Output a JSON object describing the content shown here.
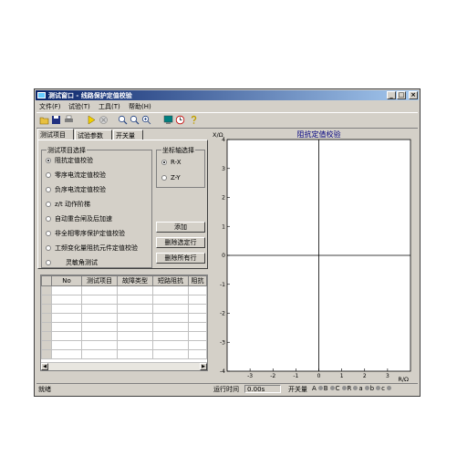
{
  "window": {
    "title": "测试窗口 - 线路保护定值校验"
  },
  "menu": [
    "文件(F)",
    "试验(T)",
    "工具(T)",
    "帮助(H)"
  ],
  "tabs": [
    "测试项目",
    "试验参数",
    "开关量"
  ],
  "test_group": {
    "title": "测试项目选择",
    "items": [
      "阻抗定值校验",
      "零序电流定值校验",
      "负序电流定值校验",
      "z/t 动作阶梯",
      "自动重合闸及后加速",
      "非全相零序保护定值校验",
      "工频变化量阻抗元件定值校验",
      "灵敏角测试"
    ],
    "selected": 0
  },
  "coord_group": {
    "title": "坐标轴选择",
    "options": [
      "R-X",
      "Z-Y"
    ],
    "selected": 0
  },
  "buttons": {
    "add": "添加",
    "delete_selected": "删除选定行",
    "delete_all": "删除所有行"
  },
  "table": {
    "headers": [
      "No",
      "测试项目",
      "故障类型",
      "短路阻抗",
      "阻抗"
    ]
  },
  "chart_data": {
    "type": "scatter",
    "title": "阻抗定值校验",
    "xlabel": "R/Ω",
    "ylabel": "X/Ω",
    "xlim": [
      -4,
      4
    ],
    "ylim": [
      -4,
      4
    ],
    "xticks": [
      -3,
      -2,
      -1,
      0,
      1,
      2,
      3
    ],
    "yticks": [
      -4,
      -3,
      -2,
      -1,
      0,
      1,
      2,
      3,
      4
    ],
    "series": []
  },
  "status": {
    "text": "就绪",
    "runtime_label": "运行时间",
    "runtime_value": "0.00s",
    "switch_label": "开关量",
    "leds": [
      "A",
      "B",
      "C",
      "R",
      "a",
      "b",
      "c"
    ]
  }
}
